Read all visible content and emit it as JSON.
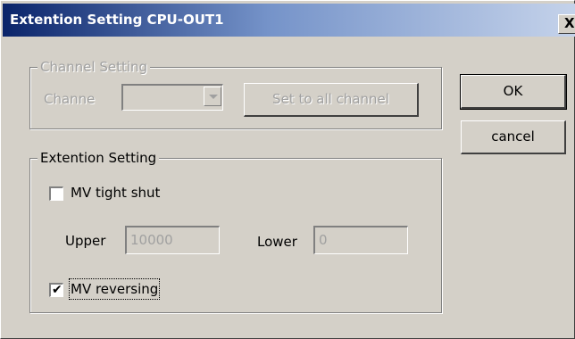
{
  "window": {
    "title": "Extention Setting CPU-OUT1",
    "close_label": "X"
  },
  "channel_setting": {
    "group_label": "Channel Setting",
    "channel_label": "Channe",
    "channel_value": "",
    "set_all_label": "Set to all channel"
  },
  "extention_setting": {
    "group_label": "Extention Setting",
    "tight_shut_label": "MV tight shut",
    "tight_shut_checked": false,
    "upper_label": "Upper",
    "upper_value": "10000",
    "lower_label": "Lower",
    "lower_value": "0",
    "reversing_label": "MV reversing",
    "reversing_checked": true
  },
  "buttons": {
    "ok_label": "OK",
    "cancel_label": "cancel"
  }
}
